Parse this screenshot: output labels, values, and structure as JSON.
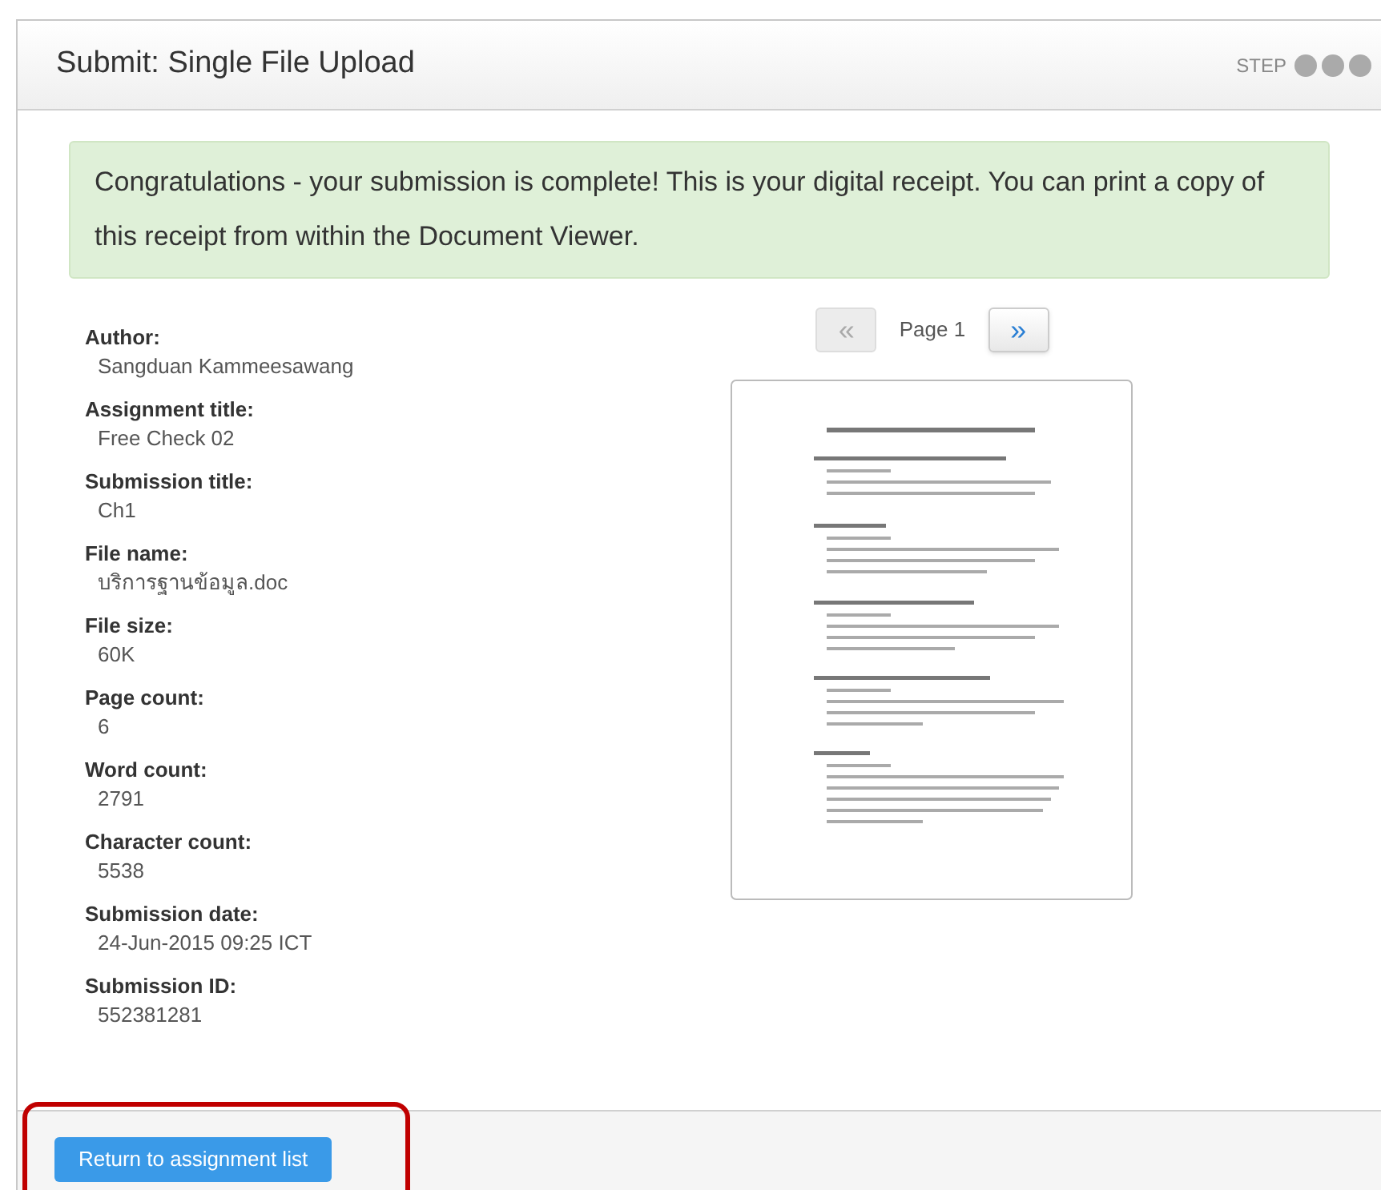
{
  "header": {
    "title": "Submit: Single File Upload",
    "step_label": "STEP",
    "steps": [
      {
        "selected": false
      },
      {
        "selected": false
      },
      {
        "selected": false
      }
    ]
  },
  "alert": {
    "text": "Congratulations - your submission is complete! This is your digital receipt. You can print a copy of this receipt from within the Document Viewer."
  },
  "details": [
    {
      "label": "Author:",
      "value": "Sangduan Kammeesawang"
    },
    {
      "label": "Assignment title:",
      "value": "Free Check 02"
    },
    {
      "label": "Submission title:",
      "value": "Ch1"
    },
    {
      "label": "File name:",
      "value": "บริการฐานข้อมูล.doc"
    },
    {
      "label": "File size:",
      "value": "60K"
    },
    {
      "label": "Page count:",
      "value": "6"
    },
    {
      "label": "Word count:",
      "value": "2791"
    },
    {
      "label": "Character count:",
      "value": "5538"
    },
    {
      "label": "Submission date:",
      "value": "24-Jun-2015 09:25 ICT"
    },
    {
      "label": "Submission ID:",
      "value": "552381281"
    }
  ],
  "viewer": {
    "prev": {
      "label": "«",
      "disabled": true
    },
    "page_label": "Page 1",
    "next": {
      "label": "»",
      "disabled": false
    }
  },
  "footer": {
    "button": "Return to assignment list",
    "highlighted": true
  }
}
